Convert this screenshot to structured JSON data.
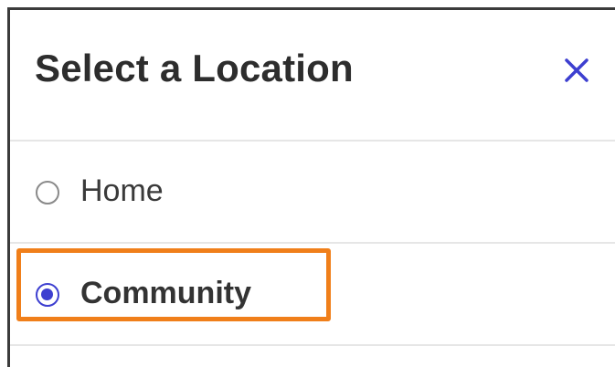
{
  "dialog": {
    "title": "Select a Location",
    "close_icon": "close-icon",
    "options": [
      {
        "label": "Home",
        "selected": false
      },
      {
        "label": "Community",
        "selected": true
      }
    ]
  },
  "colors": {
    "accent": "#3d3fd0",
    "highlight": "#f07f1a",
    "divider": "#e6e6e6",
    "title_text": "#2d2d2d"
  }
}
